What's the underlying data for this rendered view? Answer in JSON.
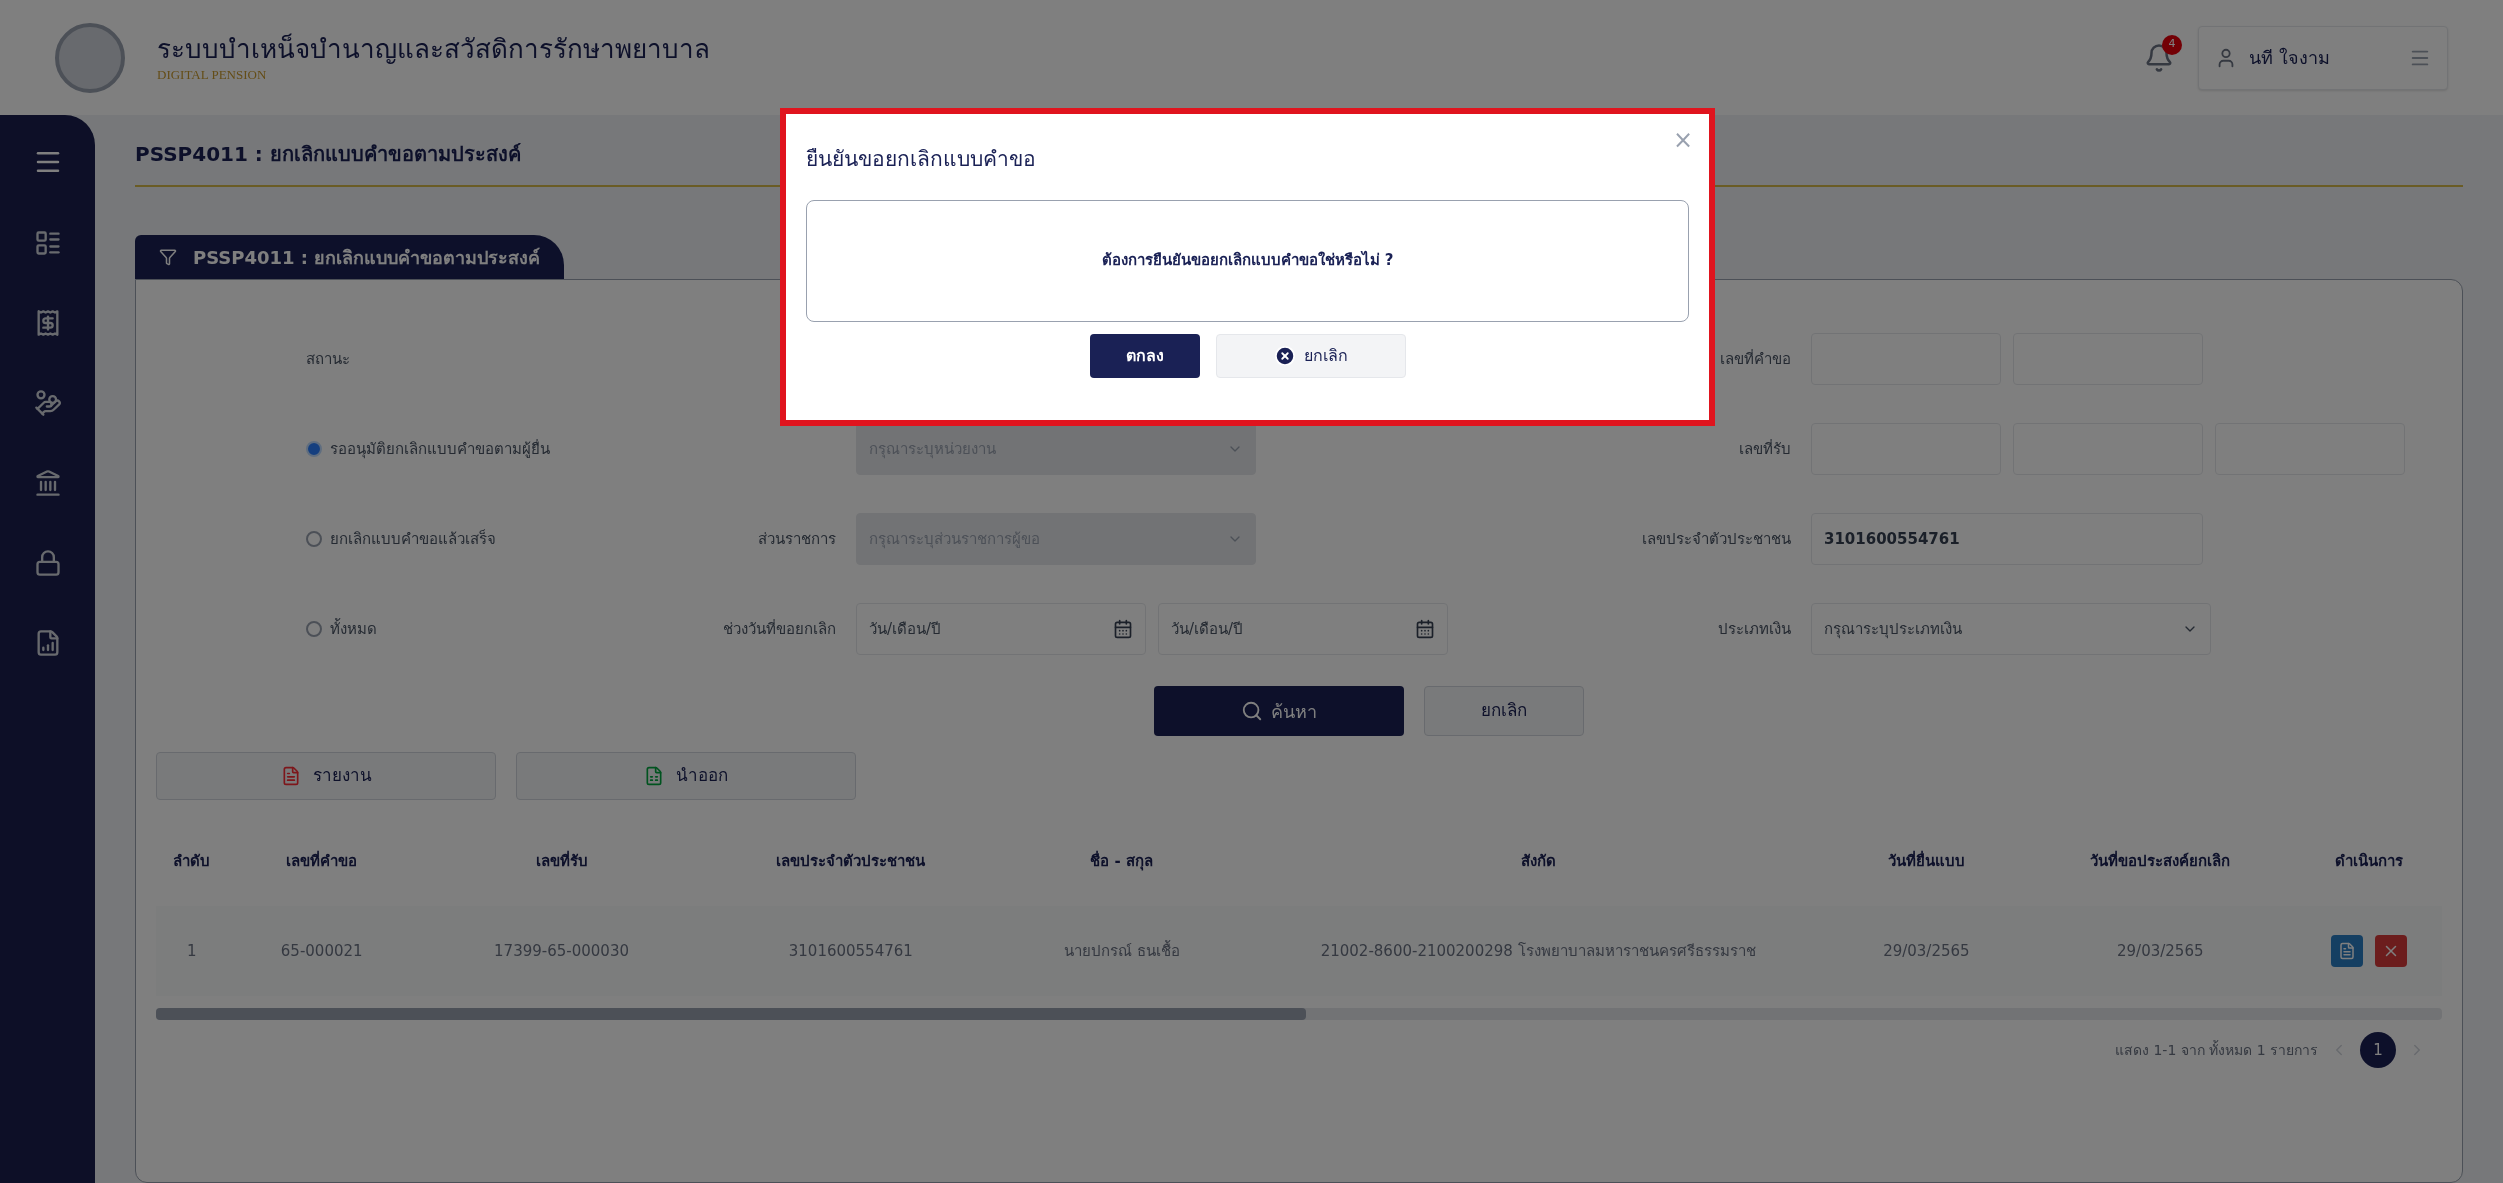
{
  "header": {
    "title": "ระบบบำเหน็จบำนาญและสวัสดิการรักษาพยาบาล",
    "subtitle": "DIGITAL PENSION",
    "notification_count": "4",
    "user_name": "นที ใจงาม"
  },
  "breadcrumb": "PSSP4011 : ยกเลิกแบบคำขอตามประสงค์",
  "panel": {
    "tab_title": "PSSP4011 : ยกเลิกแบบคำขอตามประสงค์",
    "status_label": "สถานะ",
    "status_options": [
      {
        "label": "รออนุมัติยกเลิกแบบคำขอตามผู้ยื่น",
        "selected": true
      },
      {
        "label": "ยกเลิกแบบคำขอแล้วเสร็จ",
        "selected": false
      },
      {
        "label": "ทั้งหมด",
        "selected": false
      }
    ],
    "middle_fields": [
      {
        "kind": "select",
        "placeholder": "กรุณาระบุหน่วยงาน",
        "disabled": true
      },
      {
        "kind": "select",
        "label": "ส่วนราชการ",
        "placeholder": "กรุณาระบุส่วนราชการผู้ขอ",
        "disabled": true
      },
      {
        "kind": "date_range",
        "label": "ช่วงวันที่ขอยกเลิก",
        "placeholders": [
          "วัน/เดือน/ปี",
          "วัน/เดือน/ปี"
        ]
      }
    ],
    "right_fields": [
      {
        "kind": "pair",
        "label": "เลขที่คำขอ"
      },
      {
        "kind": "triple",
        "label": "เลขที่รับ"
      },
      {
        "kind": "text",
        "label": "เลขประจำตัวประชาชน",
        "value": "3101600554761"
      },
      {
        "kind": "select",
        "label": "ประเภทเงิน",
        "placeholder": "กรุณาระบุประเภทเงิน",
        "disabled": false
      }
    ],
    "search_button": "ค้นหา",
    "clear_button": "ยกเลิก",
    "report_button": "รายงาน",
    "export_button": "นำออก"
  },
  "table": {
    "columns": [
      "ลำดับ",
      "เลขที่คำขอ",
      "เลขที่รับ",
      "เลขประจำตัวประชาชน",
      "ชื่อ - สกุล",
      "สังกัด",
      "วันที่ยื่นแบบ",
      "วันที่ขอประสงค์ยกเลิก",
      "ดำเนินการ"
    ],
    "rows": [
      {
        "cells": [
          "1",
          "65-000021",
          "17399-65-000030",
          "3101600554761",
          "นายปกรณ์ ธนเชื้อ",
          "21002-8600-2100200298 โรงพยาบาลมหาราชนครศรีธรรมราช",
          "29/03/2565",
          "29/03/2565"
        ]
      }
    ]
  },
  "pagination": {
    "summary": "แสดง 1-1 จาก ทั้งหมด 1 รายการ",
    "pages": [
      {
        "label": "1",
        "selected": true
      }
    ]
  },
  "dialog": {
    "title": "ยืนยันขอยกเลิกแบบคำขอ",
    "message": "ต้องการยืนยันขอยกเลิกแบบคำขอใช่หรือไม่ ?",
    "close": "×",
    "confirm": "ตกลง",
    "cancel": "ยกเลิก"
  }
}
